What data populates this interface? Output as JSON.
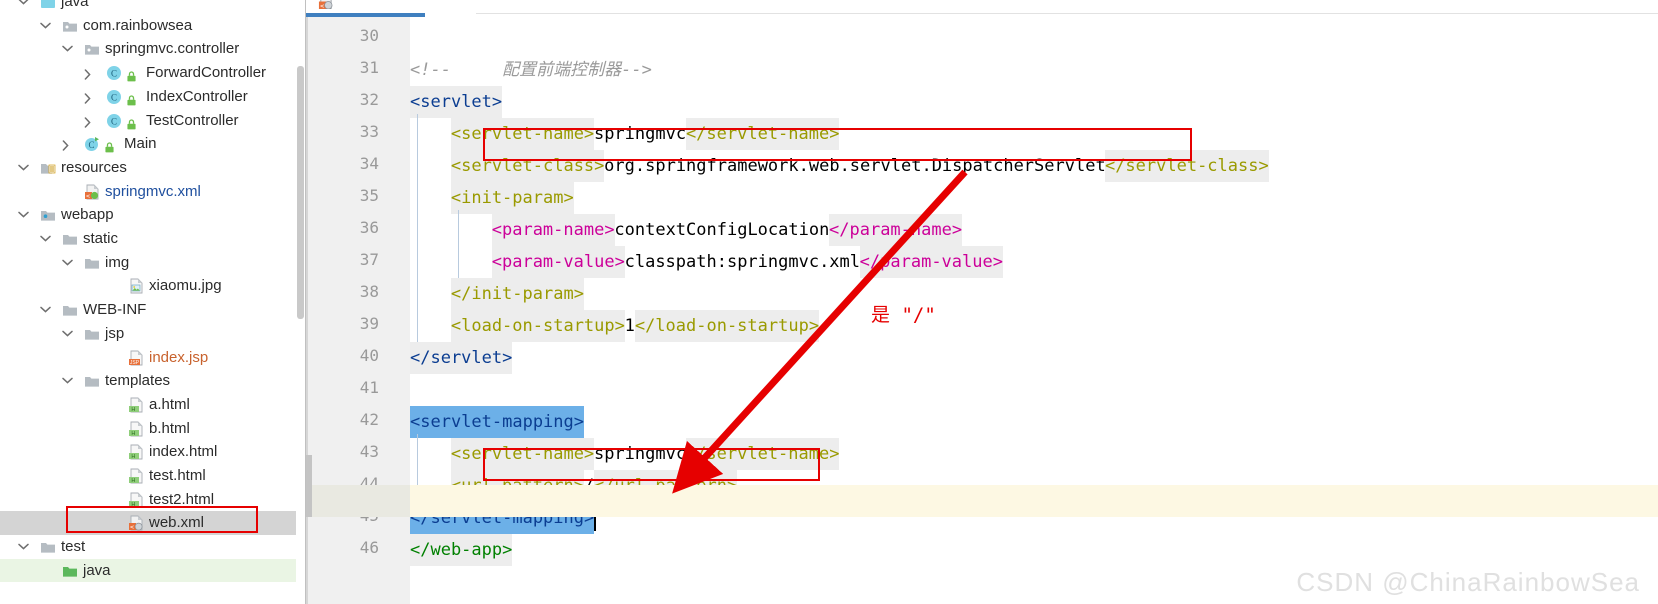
{
  "sidebar": {
    "scrollbar": "vertical-scrollbar",
    "items": [
      {
        "label": "java",
        "indent": 40,
        "arrow": "chevron-down",
        "icon": "folder-java-src",
        "style": "plain",
        "selected": false,
        "partial_top": true
      },
      {
        "label": "com.rainbowsea",
        "indent": 62,
        "arrow": "chevron-down",
        "icon": "folder-package",
        "style": "plain",
        "selected": false
      },
      {
        "label": "springmvc.controller",
        "indent": 84,
        "arrow": "chevron-down",
        "icon": "folder-package",
        "style": "plain",
        "selected": false
      },
      {
        "label": "ForwardController",
        "indent": 106,
        "arrow": "chevron-right",
        "icon": "class-icon",
        "style": "plain",
        "selected": false
      },
      {
        "label": "IndexController",
        "indent": 106,
        "arrow": "chevron-right",
        "icon": "class-icon",
        "style": "plain",
        "selected": false
      },
      {
        "label": "TestController",
        "indent": 106,
        "arrow": "chevron-right",
        "icon": "class-icon",
        "style": "plain",
        "selected": false
      },
      {
        "label": "Main",
        "indent": 84,
        "arrow": "chevron-right",
        "icon": "class-run-icon",
        "style": "plain",
        "selected": false
      },
      {
        "label": "resources",
        "indent": 40,
        "arrow": "chevron-down",
        "icon": "folder-resources",
        "style": "plain",
        "selected": false
      },
      {
        "label": "springmvc.xml",
        "indent": 84,
        "arrow": "none",
        "icon": "xml-spring-file",
        "style": "blue",
        "selected": false
      },
      {
        "label": "webapp",
        "indent": 40,
        "arrow": "chevron-down",
        "icon": "folder-webapp",
        "style": "plain",
        "selected": false
      },
      {
        "label": "static",
        "indent": 62,
        "arrow": "chevron-down",
        "icon": "folder-icon",
        "style": "plain",
        "selected": false
      },
      {
        "label": "img",
        "indent": 84,
        "arrow": "chevron-down",
        "icon": "folder-icon",
        "style": "plain",
        "selected": false
      },
      {
        "label": "xiaomu.jpg",
        "indent": 128,
        "arrow": "none",
        "icon": "image-file",
        "style": "plain",
        "selected": false
      },
      {
        "label": "WEB-INF",
        "indent": 62,
        "arrow": "chevron-down",
        "icon": "folder-icon",
        "style": "plain",
        "selected": false
      },
      {
        "label": "jsp",
        "indent": 84,
        "arrow": "chevron-down",
        "icon": "folder-icon",
        "style": "plain",
        "selected": false
      },
      {
        "label": "index.jsp",
        "indent": 128,
        "arrow": "none",
        "icon": "jsp-file",
        "style": "orange",
        "selected": false
      },
      {
        "label": "templates",
        "indent": 84,
        "arrow": "chevron-down",
        "icon": "folder-icon",
        "style": "plain",
        "selected": false
      },
      {
        "label": "a.html",
        "indent": 128,
        "arrow": "none",
        "icon": "html-file",
        "style": "plain",
        "selected": false
      },
      {
        "label": "b.html",
        "indent": 128,
        "arrow": "none",
        "icon": "html-file",
        "style": "plain",
        "selected": false
      },
      {
        "label": "index.html",
        "indent": 128,
        "arrow": "none",
        "icon": "html-file",
        "style": "plain",
        "selected": false
      },
      {
        "label": "test.html",
        "indent": 128,
        "arrow": "none",
        "icon": "html-file",
        "style": "plain",
        "selected": false
      },
      {
        "label": "test2.html",
        "indent": 128,
        "arrow": "none",
        "icon": "html-file",
        "style": "plain",
        "selected": false
      },
      {
        "label": "web.xml",
        "indent": 128,
        "arrow": "none",
        "icon": "xml-web-file",
        "style": "plain",
        "selected": true
      },
      {
        "label": "test",
        "indent": 40,
        "arrow": "chevron-down",
        "icon": "folder-icon",
        "style": "plain",
        "selected": false
      },
      {
        "label": "java",
        "indent": 62,
        "arrow": "none",
        "icon": "folder-test-src",
        "style": "plain",
        "selected": false,
        "greenbg": true
      }
    ]
  },
  "editor": {
    "tab": {
      "icon": "xml-web-file",
      "active": true
    },
    "first_line_number": 30,
    "current_line": 45,
    "caret_line": 45,
    "lines": [
      {
        "n": 30,
        "tokens": []
      },
      {
        "n": 31,
        "tokens": [
          {
            "t": "<!--     配置前端控制器-->",
            "c": "cmt",
            "hl": false
          }
        ]
      },
      {
        "n": 32,
        "tokens": [
          {
            "t": "<servlet>",
            "c": "tagnav",
            "hl": true
          }
        ],
        "fold": "collapse-expanded"
      },
      {
        "n": 33,
        "tokens": [
          {
            "t": "    ",
            "c": "txt",
            "hl": false
          },
          {
            "t": "<servlet-name>",
            "c": "tag",
            "hl": true
          },
          {
            "t": "springmvc",
            "c": "txt",
            "hl": false
          },
          {
            "t": "</servlet-name>",
            "c": "tag",
            "hl": true
          }
        ]
      },
      {
        "n": 34,
        "tokens": [
          {
            "t": "    ",
            "c": "txt",
            "hl": false
          },
          {
            "t": "<servlet-class>",
            "c": "tag",
            "hl": true
          },
          {
            "t": "org.springframework.web.servlet.DispatcherServlet",
            "c": "txt",
            "hl": false
          },
          {
            "t": "</servlet-class>",
            "c": "tag",
            "hl": true
          }
        ]
      },
      {
        "n": 35,
        "tokens": [
          {
            "t": "    ",
            "c": "txt",
            "hl": false
          },
          {
            "t": "<init-param>",
            "c": "tag",
            "hl": true
          }
        ],
        "fold": "collapse-expanded"
      },
      {
        "n": 36,
        "tokens": [
          {
            "t": "        ",
            "c": "txt",
            "hl": false
          },
          {
            "t": "<param-name>",
            "c": "tagmag",
            "hl": true
          },
          {
            "t": "contextConfigLocation",
            "c": "txt",
            "hl": false
          },
          {
            "t": "</param-name>",
            "c": "tagmag",
            "hl": true
          }
        ]
      },
      {
        "n": 37,
        "tokens": [
          {
            "t": "        ",
            "c": "txt",
            "hl": false
          },
          {
            "t": "<param-value>",
            "c": "tagmag",
            "hl": true
          },
          {
            "t": "classpath:springmvc.xml",
            "c": "txt",
            "hl": false
          },
          {
            "t": "</param-value>",
            "c": "tagmag",
            "hl": true
          }
        ]
      },
      {
        "n": 38,
        "tokens": [
          {
            "t": "    ",
            "c": "txt",
            "hl": false
          },
          {
            "t": "</init-param>",
            "c": "tag",
            "hl": true
          }
        ],
        "fold": "collapse-end"
      },
      {
        "n": 39,
        "tokens": [
          {
            "t": "    ",
            "c": "txt",
            "hl": false
          },
          {
            "t": "<load-on-startup>",
            "c": "tag",
            "hl": true
          },
          {
            "t": "1",
            "c": "txt",
            "hl": false
          },
          {
            "t": "</load-on-startup>",
            "c": "tag",
            "hl": true
          }
        ]
      },
      {
        "n": 40,
        "tokens": [
          {
            "t": "</servlet>",
            "c": "tagnav",
            "hl": true
          }
        ],
        "fold": "collapse-end"
      },
      {
        "n": 41,
        "tokens": []
      },
      {
        "n": 42,
        "tokens": [
          {
            "t": "<servlet-mapping>",
            "c": "selblue",
            "hl": false
          }
        ],
        "fold": "collapse-expanded"
      },
      {
        "n": 43,
        "tokens": [
          {
            "t": "    ",
            "c": "txt",
            "hl": false
          },
          {
            "t": "<servlet-name>",
            "c": "tag",
            "hl": true
          },
          {
            "t": "springmvc",
            "c": "txt",
            "hl": false
          },
          {
            "t": "</servlet-name>",
            "c": "tag",
            "hl": true
          }
        ]
      },
      {
        "n": 44,
        "tokens": [
          {
            "t": "    ",
            "c": "txt",
            "hl": false
          },
          {
            "t": "<url-pattern>",
            "c": "tag",
            "hl": true
          },
          {
            "t": "/",
            "c": "txt",
            "hl": false
          },
          {
            "t": "</url-pattern>",
            "c": "tag",
            "hl": true
          }
        ]
      },
      {
        "n": 45,
        "tokens": [
          {
            "t": "</servlet-mapping>",
            "c": "selblue",
            "hl": false
          }
        ],
        "fold": "collapse-end"
      },
      {
        "n": 46,
        "tokens": [
          {
            "t": "</web-app>",
            "c": "taggrn",
            "hl": true
          }
        ],
        "fold": "collapse-end"
      }
    ],
    "annotations": {
      "red_note": "是 \"/\"",
      "red_box_line34": "highlight-dispatcher-servlet-class",
      "red_box_line44": "highlight-url-pattern",
      "arrow": "red-arrow-from-servlet-class-to-url-pattern"
    }
  },
  "watermark": {
    "text": "CSDN @ChinaRainbowSea"
  },
  "colors": {
    "tag": "#9a9a00",
    "tag_navy": "#0b3d91",
    "tag_magenta": "#cc0099",
    "tag_green": "#008000",
    "comment": "#9a9a9a",
    "selection": "#6cb0e8",
    "current_line": "#fdf8e3",
    "annotation_red": "#e60000",
    "tree_selected": "#d4d4d4",
    "tab_active_underline": "#3f7fbf"
  }
}
